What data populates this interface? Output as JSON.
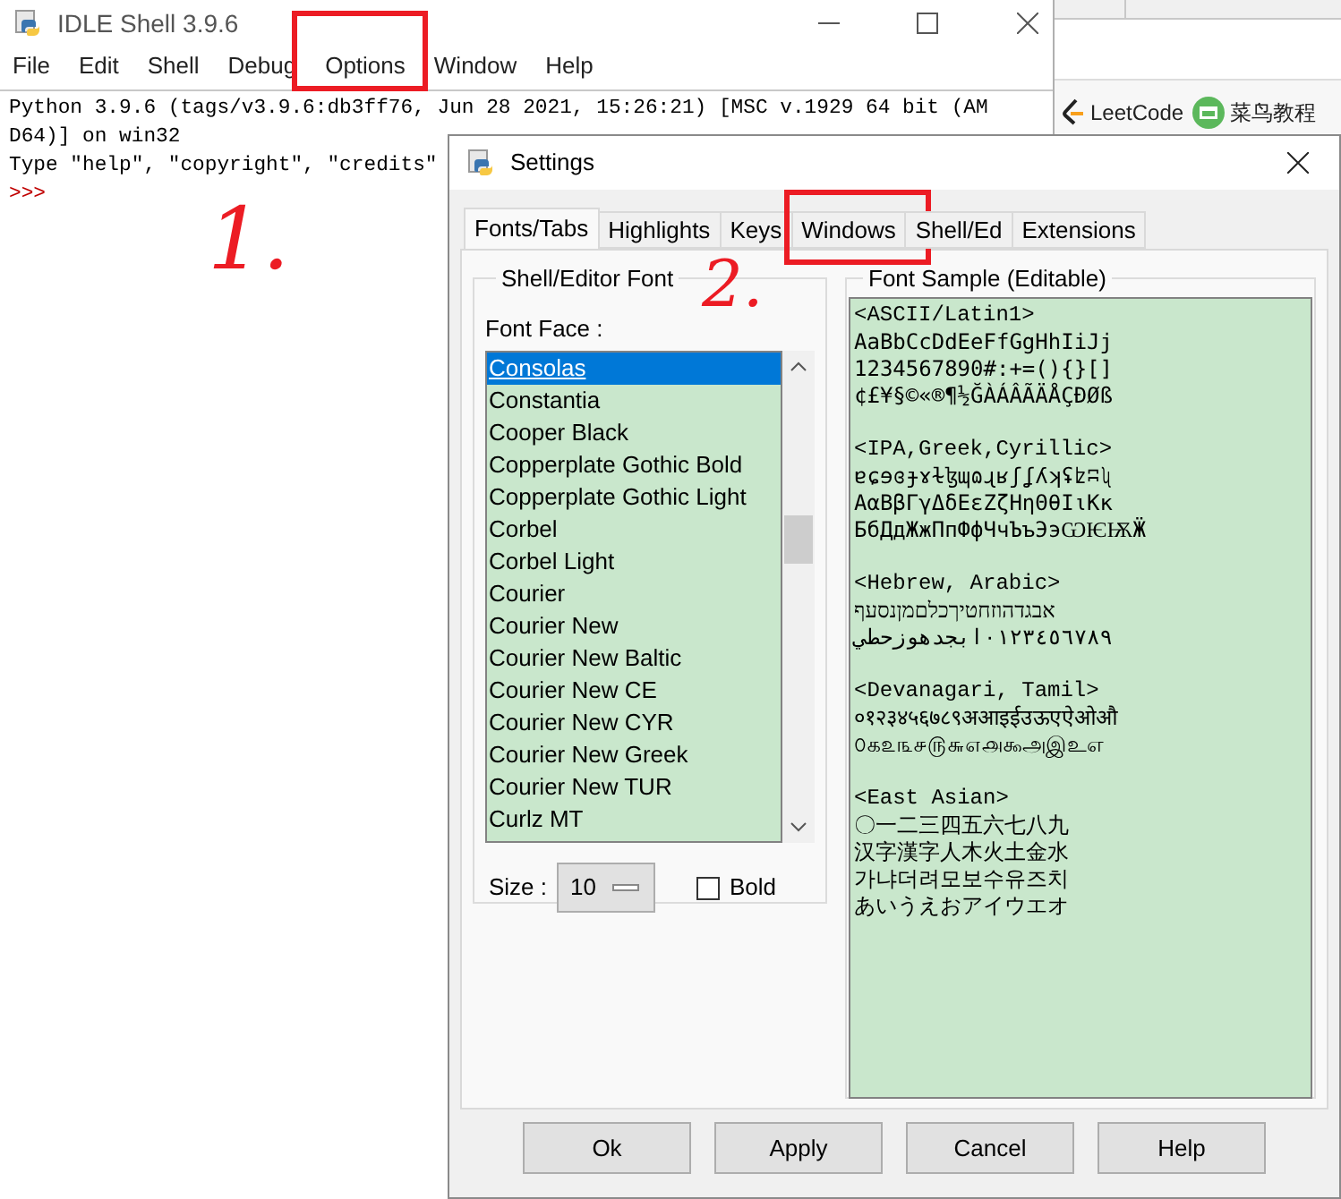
{
  "shell": {
    "title": "IDLE Shell 3.9.6",
    "menu": [
      {
        "label": "File",
        "highlighted": false
      },
      {
        "label": "Edit",
        "highlighted": false
      },
      {
        "label": "Shell",
        "highlighted": false
      },
      {
        "label": "Debug",
        "highlighted": false
      },
      {
        "label": "Options",
        "highlighted": true
      },
      {
        "label": "Window",
        "highlighted": false
      },
      {
        "label": "Help",
        "highlighted": false
      }
    ],
    "lines": [
      {
        "kind": "output",
        "text": "Python 3.9.6 (tags/v3.9.6:db3ff76, Jun 28 2021, 15:26:21) [MSC v.1929 64 bit (AM"
      },
      {
        "kind": "output",
        "text": "D64)] on win32"
      },
      {
        "kind": "output",
        "text": "Type \"help\", \"copyright\", \"credits\""
      },
      {
        "kind": "prompt",
        "text": ">>>"
      }
    ]
  },
  "browser": {
    "bookmarks": [
      {
        "label": "LeetCode",
        "kind": "leetcode"
      },
      {
        "label": "菜鸟教程",
        "kind": "runoob"
      }
    ]
  },
  "settings": {
    "title": "Settings",
    "tabs": [
      {
        "label": "Fonts/Tabs",
        "selected": true,
        "highlighted": false
      },
      {
        "label": "Highlights",
        "selected": false,
        "highlighted": false
      },
      {
        "label": "Keys",
        "selected": false,
        "highlighted": false
      },
      {
        "label": "Windows",
        "selected": false,
        "highlighted": true
      },
      {
        "label": "Shell/Ed",
        "selected": false,
        "highlighted": false
      },
      {
        "label": "Extensions",
        "selected": false,
        "highlighted": false
      }
    ],
    "font_group": {
      "title": "Shell/Editor Font",
      "font_face_label": "Font Face :",
      "fonts": [
        {
          "label": "Consolas",
          "selected": true
        },
        {
          "label": "Constantia",
          "selected": false
        },
        {
          "label": "Cooper Black",
          "selected": false
        },
        {
          "label": "Copperplate Gothic Bold",
          "selected": false
        },
        {
          "label": "Copperplate Gothic Light",
          "selected": false
        },
        {
          "label": "Corbel",
          "selected": false
        },
        {
          "label": "Corbel Light",
          "selected": false
        },
        {
          "label": "Courier",
          "selected": false
        },
        {
          "label": "Courier New",
          "selected": false
        },
        {
          "label": "Courier New Baltic",
          "selected": false
        },
        {
          "label": "Courier New CE",
          "selected": false
        },
        {
          "label": "Courier New CYR",
          "selected": false
        },
        {
          "label": "Courier New Greek",
          "selected": false
        },
        {
          "label": "Courier New TUR",
          "selected": false
        },
        {
          "label": "Curlz MT",
          "selected": false
        }
      ],
      "size_label": "Size :",
      "size_value": "10",
      "bold": {
        "label": "Bold",
        "checked": false
      }
    },
    "sample": {
      "title": "Font Sample (Editable)",
      "sections": [
        {
          "heading": "<ASCII/Latin1>",
          "lines": [
            "AaBbCcDdEeFfGgHhIiJj",
            "1234567890#:+=(){}[]",
            "¢£¥§©«®¶½ĞÀÁÂÃÄÅÇÐØß"
          ]
        },
        {
          "heading": "<IPA,Greek,Cyrillic>",
          "lines": [
            "ɐɕɘɞɟɤɫɮɰɷɻʁʃʆʎʞʢʫʭʯ",
            "ΑαΒβΓγΔδΕεΖζΗηΘθΙιΚκ",
            "БбДдЖжПпФфЧчЪъЭэѠѤѬӜ"
          ]
        },
        {
          "heading": "<Hebrew, Arabic>",
          "lines": [
            "אבגדהוזחטיךכלםמןנסעף",
            "٠١٢٣٤٥٦٧٨٩ابجدهوزحطي"
          ]
        },
        {
          "heading": "<Devanagari, Tamil>",
          "lines": [
            "०१२३४५६७८९अआइईउऊएऐओऔ",
            "௦௧௨௩௪௫௬௭௮௯அஇஉஎ"
          ]
        },
        {
          "heading": "<East Asian>",
          "lines": [
            "〇一二三四五六七八九",
            "汉字漢字人木火土金水",
            "가냐더려모보수유즈치",
            "あいうえおアイウエオ"
          ]
        }
      ]
    },
    "buttons": [
      "Ok",
      "Apply",
      "Cancel",
      "Help"
    ]
  },
  "annotations": [
    {
      "text": "1."
    },
    {
      "text": "2."
    }
  ]
}
